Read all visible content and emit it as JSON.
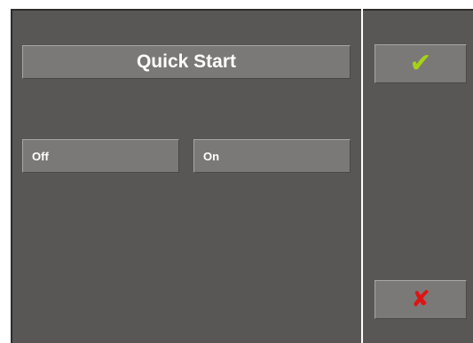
{
  "dialog": {
    "title": "Quick Start",
    "options": [
      {
        "label": "Off"
      },
      {
        "label": "On"
      }
    ]
  },
  "actions": {
    "confirm_icon": "checkmark-icon",
    "confirm_glyph": "✔",
    "confirm_color": "#a6d216",
    "cancel_icon": "cross-icon",
    "cancel_glyph": "✘",
    "cancel_color": "#e01313"
  },
  "colors": {
    "panel_background": "#595756",
    "button_background": "#7b7978",
    "text": "#ffffff"
  }
}
